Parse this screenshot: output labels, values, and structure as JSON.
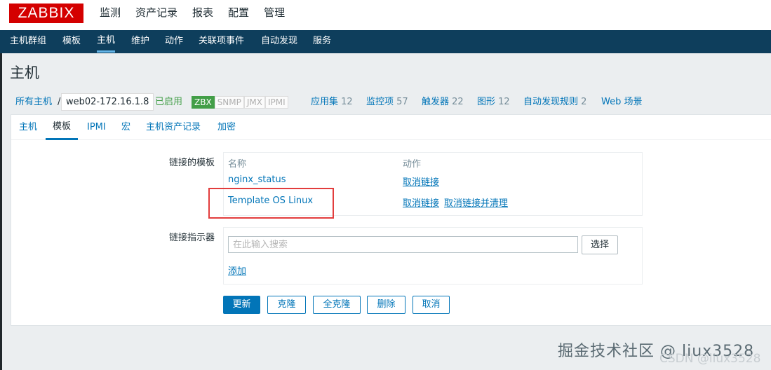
{
  "brand": {
    "logo": "ZABBIX"
  },
  "main_menu": [
    "监测",
    "资产记录",
    "报表",
    "配置",
    "管理"
  ],
  "sub_menu": [
    "主机群组",
    "模板",
    "主机",
    "维护",
    "动作",
    "关联项事件",
    "自动发现",
    "服务"
  ],
  "page": {
    "title": "主机"
  },
  "breadcrumb": {
    "all_hosts": "所有主机",
    "separator": "/",
    "host": "web02-172.16.1.8",
    "status": "已启用"
  },
  "availability": [
    "ZBX",
    "SNMP",
    "JMX",
    "IPMI"
  ],
  "host_links": [
    {
      "label": "应用集",
      "count": "12"
    },
    {
      "label": "监控项",
      "count": "57"
    },
    {
      "label": "触发器",
      "count": "22"
    },
    {
      "label": "图形",
      "count": "12"
    },
    {
      "label": "自动发现规则",
      "count": "2"
    },
    {
      "label": "Web 场景",
      "count": ""
    }
  ],
  "tabs": [
    "主机",
    "模板",
    "IPMI",
    "宏",
    "主机资产记录",
    "加密"
  ],
  "linked_templates": {
    "label": "链接的模板",
    "col_name": "名称",
    "col_action": "动作",
    "rows": [
      {
        "name": "nginx_status",
        "actions": [
          "取消链接"
        ]
      },
      {
        "name": "Template OS Linux",
        "actions": [
          "取消链接",
          "取消链接并清理"
        ]
      }
    ]
  },
  "link_indicator": {
    "label": "链接指示器",
    "placeholder": "在此输入搜索",
    "select_btn": "选择",
    "add_link": "添加"
  },
  "actions": {
    "update": "更新",
    "clone": "克隆",
    "full_clone": "全克隆",
    "delete": "删除",
    "cancel": "取消"
  },
  "watermark": {
    "main": "掘金技术社区 @ liux3528",
    "sub": "CSDN @liux3528"
  },
  "colors": {
    "nav_bg": "#0e3e5c",
    "accent": "#0275b8",
    "brand_red": "#d40000",
    "enabled_green": "#429e47",
    "highlight_red": "#e23d3d"
  }
}
